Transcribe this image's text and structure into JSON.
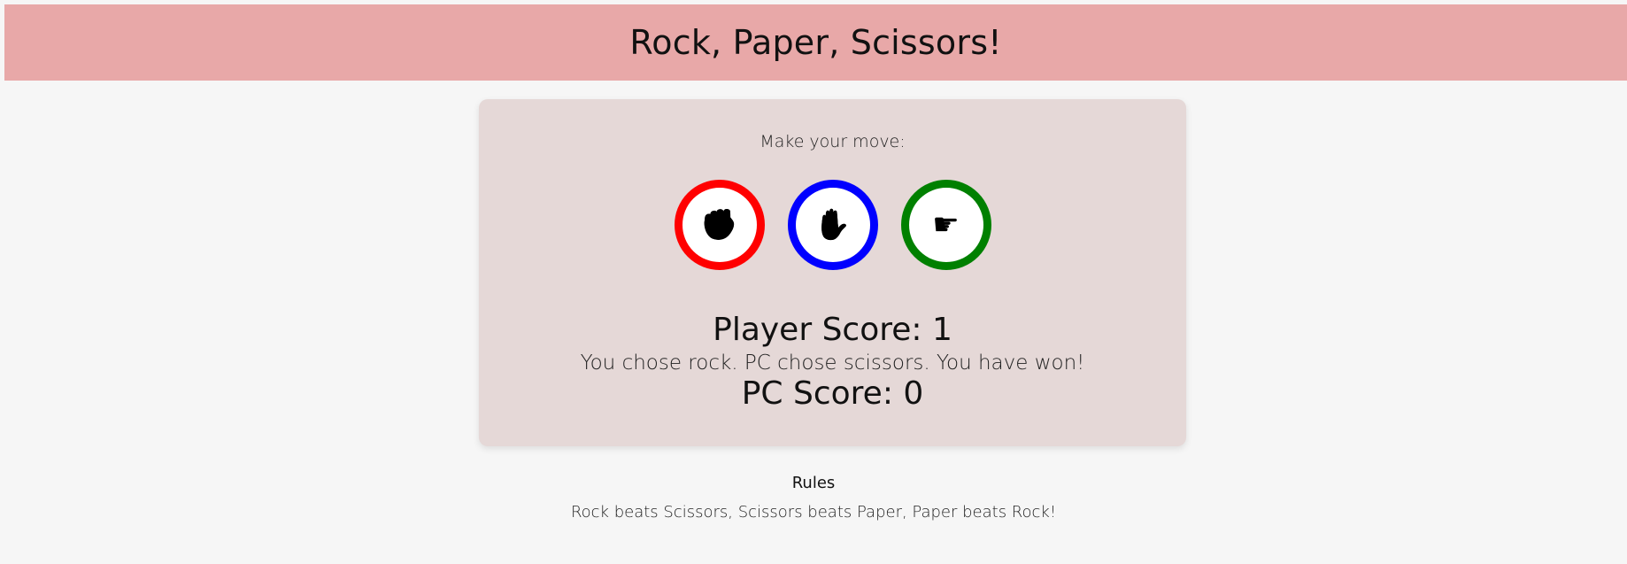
{
  "header": {
    "title": "Rock, Paper, Scissors!"
  },
  "game": {
    "prompt": "Make your move:",
    "choices": [
      {
        "name": "rock",
        "icon": "fist-icon",
        "glyph": "✊",
        "color": "#ff0000"
      },
      {
        "name": "paper",
        "icon": "open-hand-icon",
        "glyph": "✋",
        "color": "#0000ff"
      },
      {
        "name": "scissors",
        "icon": "pointing-hand-icon",
        "glyph": "☛",
        "color": "#008000"
      }
    ],
    "player_score": "Player Score: 1",
    "result": "You chose rock. PC chose scissors. You have won!",
    "pc_score": "PC Score: 0"
  },
  "rules": {
    "title": "Rules",
    "text": "Rock beats Scissors, Scissors beats Paper, Paper beats Rock!"
  },
  "colors": {
    "header_bg": "#e8a8a8",
    "card_bg": "#e5d8d7",
    "page_bg": "#f6f6f6"
  }
}
